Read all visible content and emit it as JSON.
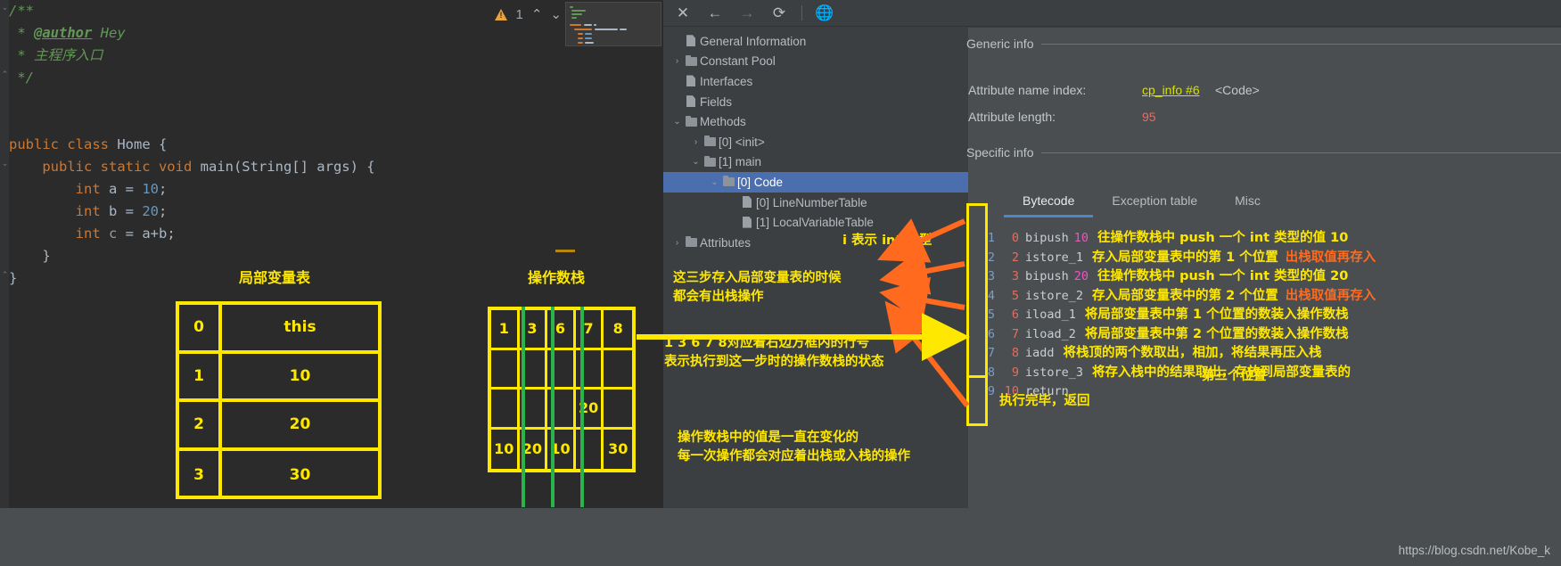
{
  "editor": {
    "code_lines": [
      [
        {
          "t": "/**",
          "c": "c-cmt"
        }
      ],
      [
        {
          "t": " * ",
          "c": "c-cmt"
        },
        {
          "t": "@author",
          "c": "c-cmt-b"
        },
        {
          "t": " Hey",
          "c": "c-cmt"
        }
      ],
      [
        {
          "t": " * 主程序入口",
          "c": "c-cmt"
        }
      ],
      [
        {
          "t": " */",
          "c": "c-cmt"
        }
      ],
      [
        {
          "t": "",
          "c": "c-txt"
        }
      ],
      [
        {
          "t": "",
          "c": "c-txt"
        }
      ],
      [
        {
          "t": "public class ",
          "c": "c-kw"
        },
        {
          "t": "Home ",
          "c": "c-txt"
        },
        {
          "t": "{",
          "c": "c-txt"
        }
      ],
      [
        {
          "t": "    ",
          "c": "c-txt"
        },
        {
          "t": "public static void ",
          "c": "c-kw"
        },
        {
          "t": "main",
          "c": "c-txt"
        },
        {
          "t": "(String[] args) {",
          "c": "c-txt"
        }
      ],
      [
        {
          "t": "        ",
          "c": "c-txt"
        },
        {
          "t": "int ",
          "c": "c-kw"
        },
        {
          "t": "a = ",
          "c": "c-txt"
        },
        {
          "t": "10",
          "c": "c-num"
        },
        {
          "t": ";",
          "c": "c-txt"
        }
      ],
      [
        {
          "t": "        ",
          "c": "c-txt"
        },
        {
          "t": "int ",
          "c": "c-kw"
        },
        {
          "t": "b = ",
          "c": "c-txt"
        },
        {
          "t": "20",
          "c": "c-num"
        },
        {
          "t": ";",
          "c": "c-txt"
        }
      ],
      [
        {
          "t": "        ",
          "c": "c-txt"
        },
        {
          "t": "int ",
          "c": "c-kw"
        },
        {
          "t": "c",
          "c": "c-grey"
        },
        {
          "t": " = a+b;",
          "c": "c-txt"
        }
      ],
      [
        {
          "t": "    }",
          "c": "c-txt"
        }
      ],
      [
        {
          "t": "}",
          "c": "c-txt"
        }
      ]
    ],
    "warning_count": "1",
    "warning_icon": "warning-triangle-icon",
    "prev_icon": "chevron-up-icon",
    "next_icon": "chevron-down-icon"
  },
  "local_variable_table": {
    "title": "局部变量表",
    "rows": [
      {
        "index": "0",
        "value": "this"
      },
      {
        "index": "1",
        "value": "10"
      },
      {
        "index": "2",
        "value": "20"
      },
      {
        "index": "3",
        "value": "30"
      }
    ]
  },
  "operand_stack": {
    "title": "操作数栈",
    "step_headers": [
      "1",
      "3",
      "6",
      "7",
      "8"
    ],
    "cells": [
      [
        "",
        "",
        "",
        "",
        ""
      ],
      [
        "",
        "",
        "",
        "20",
        ""
      ],
      [
        "10",
        "20",
        "10",
        "",
        "30"
      ]
    ]
  },
  "jclasslib": {
    "toolbar": {
      "close": "✕",
      "back": "←",
      "forward": "→",
      "reload": "⟳",
      "browse": "🌐"
    },
    "tree": [
      {
        "label": "General Information",
        "icon": "file-icon",
        "arrow": "",
        "indent": 1,
        "selected": false
      },
      {
        "label": "Constant Pool",
        "icon": "folder-icon",
        "arrow": "›",
        "indent": 1,
        "selected": false
      },
      {
        "label": "Interfaces",
        "icon": "file-icon",
        "arrow": "",
        "indent": 1,
        "selected": false
      },
      {
        "label": "Fields",
        "icon": "file-icon",
        "arrow": "",
        "indent": 1,
        "selected": false
      },
      {
        "label": "Methods",
        "icon": "folder-icon",
        "arrow": "⌄",
        "indent": 1,
        "selected": false
      },
      {
        "label": "[0] <init>",
        "icon": "folder-icon",
        "arrow": "›",
        "indent": 2,
        "selected": false
      },
      {
        "label": "[1] main",
        "icon": "folder-icon",
        "arrow": "⌄",
        "indent": 2,
        "selected": false
      },
      {
        "label": "[0] Code",
        "icon": "folder-icon",
        "arrow": "⌄",
        "indent": 3,
        "selected": true
      },
      {
        "label": "[0] LineNumberTable",
        "icon": "file-icon",
        "arrow": "",
        "indent": 4,
        "selected": false
      },
      {
        "label": "[1] LocalVariableTable",
        "icon": "file-icon",
        "arrow": "",
        "indent": 4,
        "selected": false
      },
      {
        "label": "Attributes",
        "icon": "folder-icon",
        "arrow": "›",
        "indent": 1,
        "selected": false
      }
    ],
    "generic_info": {
      "heading": "Generic info",
      "attribute_name_index_label": "Attribute name index:",
      "attribute_name_index_link": "cp_info #6",
      "attribute_name_index_type": "<Code>",
      "attribute_length_label": "Attribute length:",
      "attribute_length_value": "95"
    },
    "specific_info": {
      "heading": "Specific info"
    },
    "tabs": [
      {
        "label": "Bytecode",
        "active": true
      },
      {
        "label": "Exception table",
        "active": false
      },
      {
        "label": "Misc",
        "active": false
      }
    ],
    "bytecode": [
      {
        "line": "1",
        "offset": "0",
        "op": "bipush",
        "arg": "10",
        "note": "往操作数栈中 push 一个 int 类型的值 10",
        "note2": ""
      },
      {
        "line": "2",
        "offset": "2",
        "op": "istore_1",
        "arg": "",
        "note": "存入局部变量表中的第 1 个位置",
        "note2": "出栈取值再存入"
      },
      {
        "line": "3",
        "offset": "3",
        "op": "bipush",
        "arg": "20",
        "note": "往操作数栈中 push 一个 int 类型的值 20",
        "note2": ""
      },
      {
        "line": "4",
        "offset": "5",
        "op": "istore_2",
        "arg": "",
        "note": "存入局部变量表中的第 2 个位置",
        "note2": "出栈取值再存入"
      },
      {
        "line": "5",
        "offset": "6",
        "op": "iload_1",
        "arg": "",
        "note": "将局部变量表中第 1 个位置的数装入操作数栈",
        "note2": ""
      },
      {
        "line": "6",
        "offset": "7",
        "op": "iload_2",
        "arg": "",
        "note": "将局部变量表中第 2 个位置的数装入操作数栈",
        "note2": ""
      },
      {
        "line": "7",
        "offset": "8",
        "op": "iadd",
        "arg": "",
        "note": "将栈顶的两个数取出，相加，将结果再压入栈",
        "note2": ""
      },
      {
        "line": "8",
        "offset": "9",
        "op": "istore_3",
        "arg": "",
        "note": "将存入栈中的结果取出，存放到局部变量表的",
        "note2": ""
      },
      {
        "line": "9",
        "offset": "10",
        "op": "return",
        "arg": "",
        "note": "",
        "note2": ""
      }
    ],
    "bytecode_trailing_notes": [
      {
        "text": "第三个位置"
      },
      {
        "text": "执行完毕，返回"
      }
    ]
  },
  "annotations": {
    "int_type": "i 表示 int 类型",
    "store_popnote": "这三步存入局部变量表的时候\n都会有出栈操作",
    "linenum_note": "1 3 6 7 8对应着右边方框内的行号\n表示执行到这一步时的操作数栈的状态",
    "stack_change_note": "操作数栈中的值是一直在变化的\n每一次操作都会对应着出栈或入栈的操作"
  },
  "watermark": "https://blog.csdn.net/Kobe_k",
  "colors": {
    "yellow": "#ffe800",
    "orange": "#ff6a1e",
    "green": "#2ab34a",
    "selection_blue": "#4b6eaf",
    "editor_bg": "#2b2b2b",
    "panel_bg": "#3c3f41",
    "detail_bg": "#4a4e50"
  }
}
